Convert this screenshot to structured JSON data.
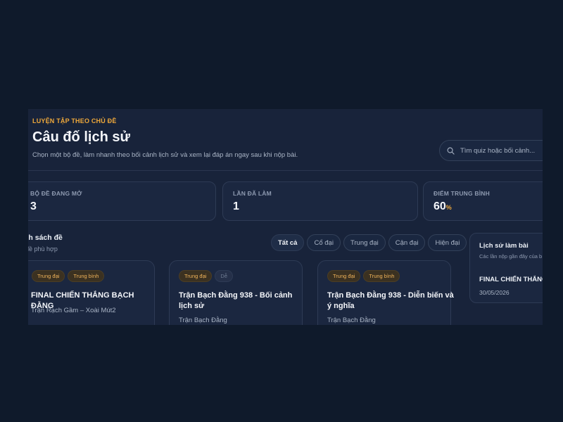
{
  "header": {
    "eyebrow": "LUYỆN TẬP THEO CHỦ ĐỀ",
    "title": "Câu đố lịch sử",
    "subtitle": "Chọn một bộ đề, làm nhanh theo bối cảnh lịch sử và xem lại đáp án ngay sau khi nộp bài.",
    "search_placeholder": "Tìm quiz hoặc bối cảnh..."
  },
  "stats": [
    {
      "label": "BỘ ĐỀ ĐANG MỞ",
      "value": "3",
      "suffix": ""
    },
    {
      "label": "LẦN ĐÃ LÀM",
      "value": "1",
      "suffix": ""
    },
    {
      "label": "ĐIỂM TRUNG BÌNH",
      "value": "60",
      "suffix": "%"
    }
  ],
  "list": {
    "title": "nh sách đề",
    "subtitle": "đề phù hợp"
  },
  "filters": [
    "Tất cả",
    "Cổ đại",
    "Trung đại",
    "Cận đại",
    "Hiện đại"
  ],
  "active_filter": "Tất cả",
  "cards": [
    {
      "tags": [
        "Trung đại",
        "Trung bình"
      ],
      "title": "FINAL CHIẾN THẮNG BẠCH ĐẰNG",
      "sub": "Trận Rạch Gầm – Xoài Mút2"
    },
    {
      "tags": [
        "Trung đại",
        "Dễ"
      ],
      "title": "Trận Bạch Đằng 938 - Bối cảnh lịch sử",
      "sub": "Trận Bạch Đằng"
    },
    {
      "tags": [
        "Trung đại",
        "Trung bình"
      ],
      "title": "Trận Bạch Đằng 938 - Diễn biến và ý nghĩa",
      "sub": "Trận Bạch Đằng"
    }
  ],
  "history": {
    "title": "Lịch sử làm bài",
    "subtitle": "Các lần nộp gần đây của b",
    "item_title": "FINAL CHIẾN THẮNG",
    "item_date": "30/05/2026"
  },
  "colors": {
    "background": "#0f1a2b",
    "panel": "#18233a",
    "accent": "#f0a93a"
  }
}
